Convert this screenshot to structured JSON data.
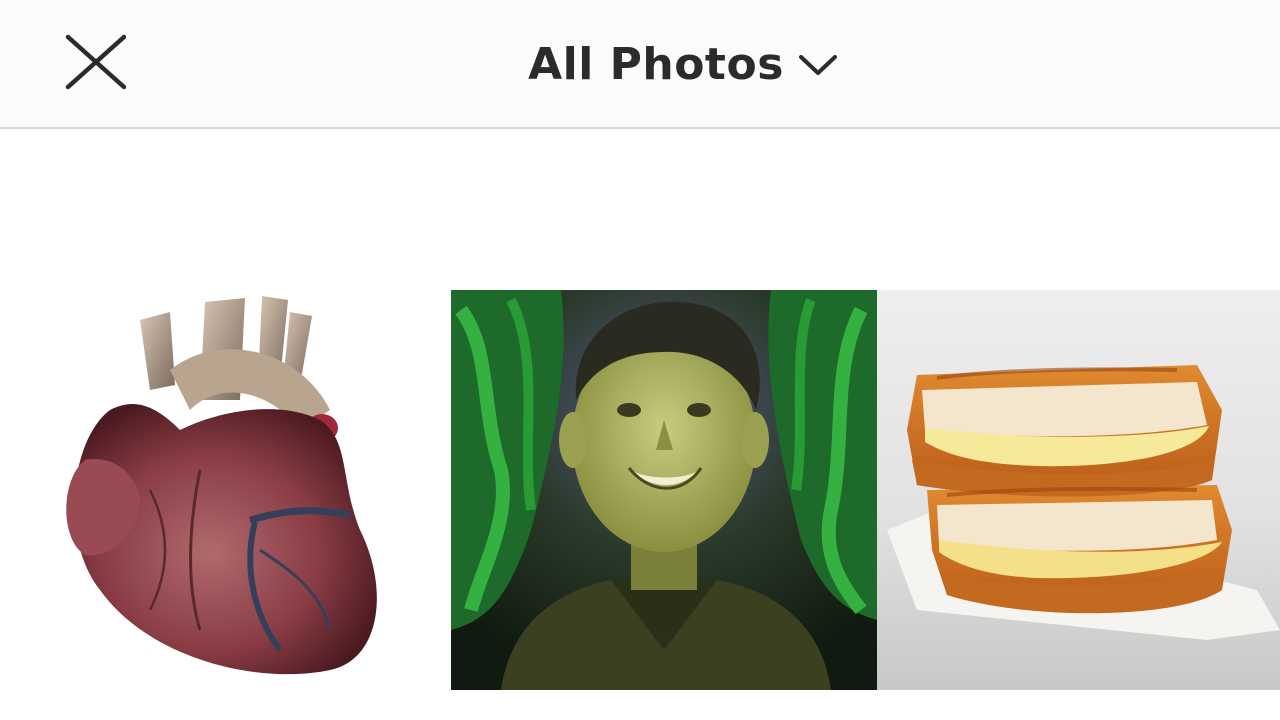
{
  "header": {
    "title": "All Photos",
    "close_icon": "close-icon",
    "dropdown_icon": "chevron-down-icon"
  },
  "photos": [
    {
      "subject": "anatomical-heart"
    },
    {
      "subject": "smiling-boy-portrait"
    },
    {
      "subject": "grilled-cheese-sandwich"
    }
  ],
  "colors": {
    "header_bg": "#fbfbfb",
    "divider": "#d6d6d6",
    "title": "#2b2b2b"
  }
}
